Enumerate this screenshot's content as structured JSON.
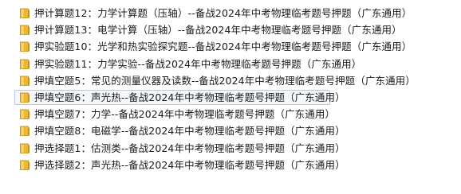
{
  "files": [
    {
      "name": "押计算题12：力学计算题（压轴）--备战2024年中考物理临考题号押题（广东通用）",
      "icon": "folder-icon"
    },
    {
      "name": "押计算题13：电学计算（压轴）--备战2024年中考物理临考题号押题（广东通用）",
      "icon": "folder-icon"
    },
    {
      "name": "押实验题10：光学和热实验探究题--备战2024年中考物理临考题号押题（广东通用）",
      "icon": "folder-icon"
    },
    {
      "name": "押实验题11：力学实验--备战2024年中考物理临考题号押题（广东通用）",
      "icon": "folder-icon"
    },
    {
      "name": "押填空题5：常见的测量仪器及读数--备战2024年中考物理临考题号押题（广东通用）",
      "icon": "folder-icon"
    },
    {
      "name": "押填空题6：声光热--备战2024年中考物理临考题号押题（广东通用）",
      "icon": "folder-icon",
      "selected": true
    },
    {
      "name": "押填空题7：力学--备战2024年中考物理临考题号押题（广东通用）",
      "icon": "folder-icon"
    },
    {
      "name": "押填空题8：电磁学--备战2024年中考物理临考题号押题（广东通用）",
      "icon": "folder-icon"
    },
    {
      "name": "押选择题1：估测类--备战2024年中考物理临考题号押题（广东通用）",
      "icon": "folder-icon"
    },
    {
      "name": "押选择题2：声光热--备战2024年中考物理临考题号押题（广东通用）",
      "icon": "folder-icon"
    }
  ],
  "colors": {
    "folder_body": "#e8b83a",
    "folder_dark": "#c98f1c",
    "folder_light": "#f8dc7e",
    "selection_border": "#b9c8de",
    "selection_fill": "#f4f7fc"
  }
}
